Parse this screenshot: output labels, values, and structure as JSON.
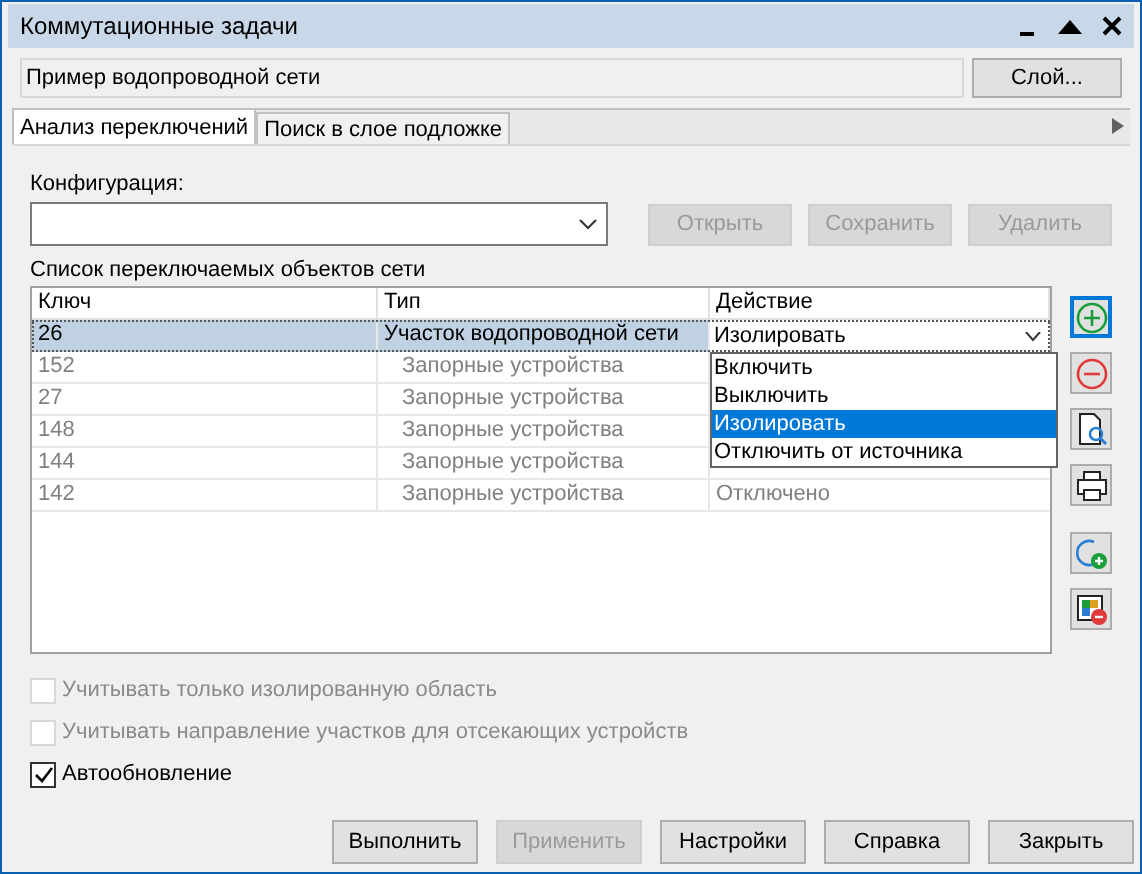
{
  "window": {
    "title": "Коммутационные задачи"
  },
  "network": {
    "value": "Пример водопроводной сети",
    "button": "Слой..."
  },
  "tabs": [
    {
      "label": "Анализ переключений",
      "selected": true
    },
    {
      "label": "Поиск в слое подложке",
      "selected": false
    }
  ],
  "configuration": {
    "label": "Конфигурация:",
    "buttons": [
      {
        "label": "Открыть",
        "disabled": true
      },
      {
        "label": "Сохранить",
        "disabled": true
      },
      {
        "label": "Удалить",
        "disabled": true
      }
    ]
  },
  "table": {
    "title": "Список переключаемых объектов сети",
    "columns": [
      "Ключ",
      "Тип",
      "Действие"
    ],
    "rows": [
      {
        "key": "26",
        "type": "Участок водопроводной сети",
        "action": "Изолировать",
        "selected": true,
        "disabled": false
      },
      {
        "key": "152",
        "type": "Запорные устройства",
        "selected": false,
        "disabled": true
      },
      {
        "key": "27",
        "type": "Запорные устройства",
        "selected": false,
        "disabled": true
      },
      {
        "key": "148",
        "type": "Запорные устройства",
        "selected": false,
        "disabled": true
      },
      {
        "key": "144",
        "type": "Запорные устройства",
        "selected": false,
        "disabled": true
      },
      {
        "key": "142",
        "type": "Запорные устройства",
        "action": "Отключено",
        "selected": false,
        "disabled": true
      }
    ]
  },
  "dropdown_options": [
    {
      "label": "Включить",
      "selected": false
    },
    {
      "label": "Выключить",
      "selected": false
    },
    {
      "label": "Изолировать",
      "selected": true
    },
    {
      "label": "Отключить от источника",
      "selected": false
    }
  ],
  "side_buttons": [
    {
      "kind": "add"
    },
    {
      "kind": "remove"
    },
    {
      "kind": "preview"
    },
    {
      "kind": "print"
    },
    {
      "kind": "add-layer"
    },
    {
      "kind": "legend"
    }
  ],
  "options": [
    {
      "label": "Учитывать только изолированную область",
      "checked": false,
      "disabled": true
    },
    {
      "label": "Учитывать направление участков для отсекающих устройств",
      "checked": false,
      "disabled": true
    },
    {
      "label": "Автообновление",
      "checked": true,
      "disabled": false
    }
  ],
  "buttons": [
    {
      "label": "Выполнить",
      "disabled": false
    },
    {
      "label": "Применить",
      "disabled": true
    },
    {
      "label": "Настройки",
      "disabled": false
    },
    {
      "label": "Справка",
      "disabled": false
    },
    {
      "label": "Закрыть",
      "disabled": false
    }
  ]
}
